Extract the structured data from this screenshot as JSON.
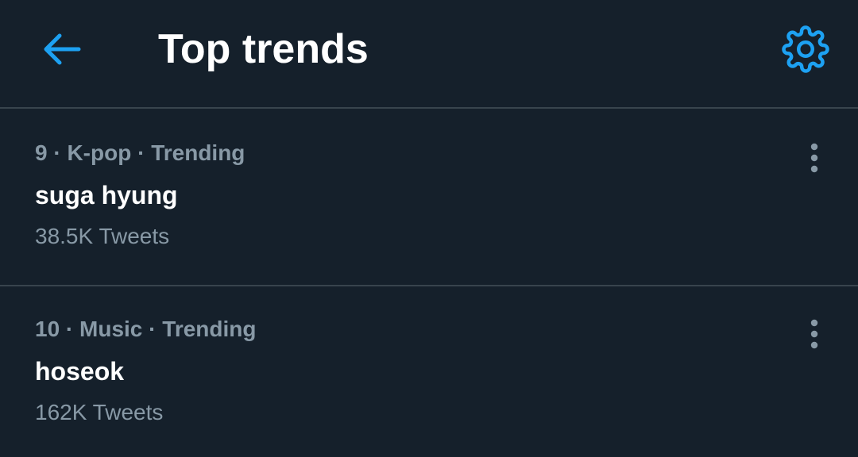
{
  "header": {
    "title": "Top trends",
    "back_icon": "arrow-left-icon",
    "settings_icon": "gear-icon"
  },
  "trends": [
    {
      "rank": "9",
      "category": "K-pop",
      "status": "Trending",
      "meta": "9 · K-pop · Trending",
      "name": "suga hyung",
      "tweet_count": "38.5K Tweets"
    },
    {
      "rank": "10",
      "category": "Music",
      "status": "Trending",
      "meta": "10 · Music · Trending",
      "name": "hoseok",
      "tweet_count": "162K Tweets"
    }
  ],
  "colors": {
    "background": "#15202b",
    "accent": "#1da1f2",
    "secondary_text": "#8899a6",
    "divider": "#38444d"
  }
}
